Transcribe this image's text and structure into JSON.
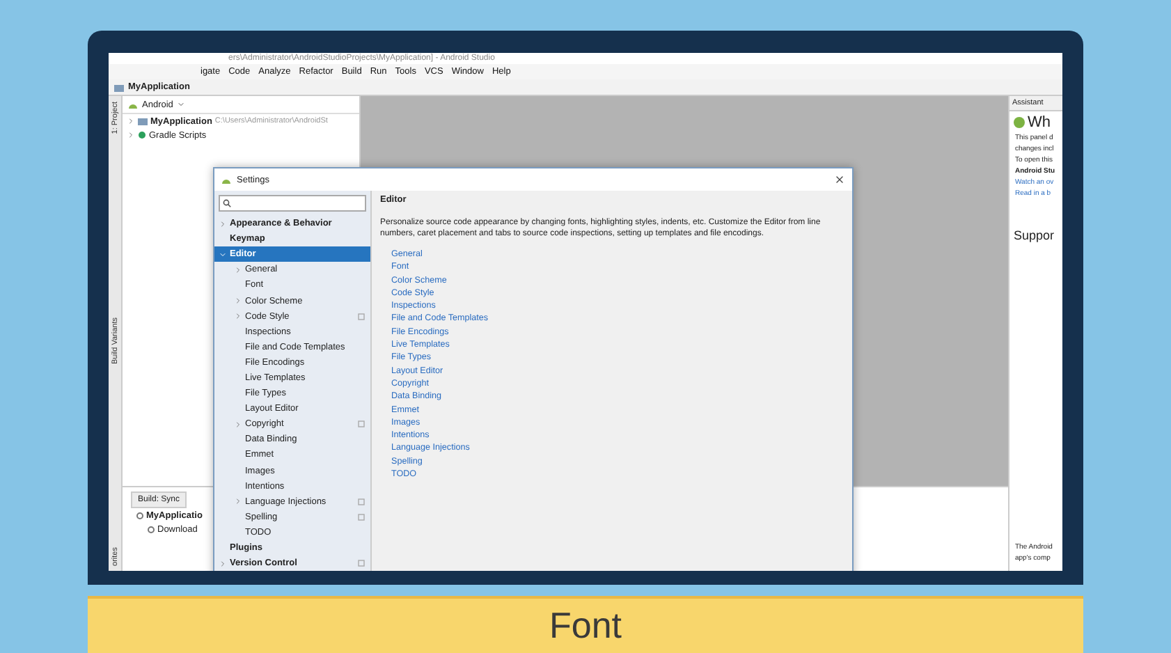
{
  "window": {
    "title": "ers\\Administrator\\AndroidStudioProjects\\MyApplication] - Android Studio"
  },
  "menu": [
    "igate",
    "Code",
    "Analyze",
    "Refactor",
    "Build",
    "Run",
    "Tools",
    "VCS",
    "Window",
    "Help"
  ],
  "breadcrumb": "MyApplication",
  "side_tabs": [
    "1: Project",
    "Build Variants",
    "orites"
  ],
  "project": {
    "view": "Android",
    "tree": [
      {
        "label": "MyApplication",
        "path": "C:\\Users\\Administrator\\AndroidSt",
        "kind": "module"
      },
      {
        "label": "Gradle Scripts",
        "kind": "gradle"
      }
    ]
  },
  "build": {
    "tab": "Build: Sync",
    "tree": [
      {
        "label": "MyApplicatio",
        "kind": "root"
      },
      {
        "label": "Download",
        "kind": "child"
      }
    ]
  },
  "assistant": {
    "title": "Assistant",
    "heading": "Wh",
    "lines": [
      {
        "text": "This panel d",
        "kind": "plain"
      },
      {
        "text": "changes incl",
        "kind": "plain"
      },
      {
        "text": "To open this",
        "kind": "plain"
      },
      {
        "text": "Android Stu",
        "kind": "bold"
      },
      {
        "text": "Watch an ov",
        "kind": "link"
      },
      {
        "text": "Read in a b",
        "kind": "link"
      }
    ],
    "section": "Suppor",
    "footer": [
      "The Android",
      "app's comp"
    ]
  },
  "dialog": {
    "title": "Settings",
    "nav": [
      {
        "label": "Appearance & Behavior",
        "bold": true,
        "arrow": true,
        "selected": false,
        "project": false
      },
      {
        "label": "Keymap",
        "bold": true,
        "arrow": false,
        "selected": false,
        "project": false
      },
      {
        "label": "Editor",
        "bold": true,
        "arrow": true,
        "selected": true,
        "project": false,
        "expanded": true,
        "children": [
          {
            "label": "General",
            "arrow": true,
            "selected": false,
            "project": false
          },
          {
            "label": "Font",
            "arrow": false,
            "selected": false,
            "project": false
          },
          {
            "label": "Color Scheme",
            "arrow": true,
            "selected": false,
            "project": false
          },
          {
            "label": "Code Style",
            "arrow": true,
            "selected": false,
            "project": true
          },
          {
            "label": "Inspections",
            "arrow": false,
            "selected": false,
            "project": false
          },
          {
            "label": "File and Code Templates",
            "arrow": false,
            "selected": false,
            "project": false
          },
          {
            "label": "File Encodings",
            "arrow": false,
            "selected": false,
            "project": false
          },
          {
            "label": "Live Templates",
            "arrow": false,
            "selected": false,
            "project": false
          },
          {
            "label": "File Types",
            "arrow": false,
            "selected": false,
            "project": false
          },
          {
            "label": "Layout Editor",
            "arrow": false,
            "selected": false,
            "project": false
          },
          {
            "label": "Copyright",
            "arrow": true,
            "selected": false,
            "project": true
          },
          {
            "label": "Data Binding",
            "arrow": false,
            "selected": false,
            "project": false
          },
          {
            "label": "Emmet",
            "arrow": false,
            "selected": false,
            "project": false
          },
          {
            "label": "Images",
            "arrow": false,
            "selected": false,
            "project": false
          },
          {
            "label": "Intentions",
            "arrow": false,
            "selected": false,
            "project": false
          },
          {
            "label": "Language Injections",
            "arrow": true,
            "selected": false,
            "project": true
          },
          {
            "label": "Spelling",
            "arrow": false,
            "selected": false,
            "project": true
          },
          {
            "label": "TODO",
            "arrow": false,
            "selected": false,
            "project": false
          }
        ]
      },
      {
        "label": "Plugins",
        "bold": true,
        "arrow": false,
        "selected": false,
        "project": false
      },
      {
        "label": "Version Control",
        "bold": true,
        "arrow": true,
        "selected": false,
        "project": true
      }
    ],
    "content": {
      "heading": "Editor",
      "description": "Personalize source code appearance by changing fonts, highlighting styles, indents, etc. Customize the Editor from line numbers, caret placement and tabs to source code inspections, setting up templates and file encodings.",
      "links": [
        "General",
        "Font",
        "Color Scheme",
        "Code Style",
        "Inspections",
        "File and Code Templates",
        "File Encodings",
        "Live Templates",
        "File Types",
        "Layout Editor",
        "Copyright",
        "Data Binding",
        "Emmet",
        "Images",
        "Intentions",
        "Language Injections",
        "Spelling",
        "TODO"
      ]
    }
  },
  "caption": "Font"
}
